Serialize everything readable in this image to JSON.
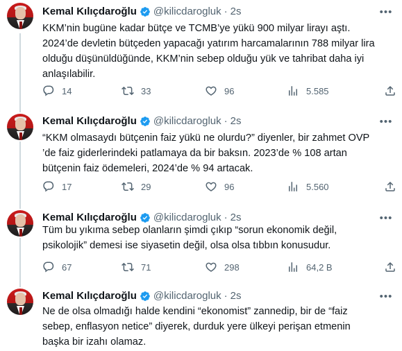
{
  "author": {
    "name": "Kemal Kılıçdaroğlu",
    "handle": "@kilicdarogluk",
    "separator": "·",
    "time": "2s"
  },
  "tweets": [
    {
      "text": "KKM’nin bugüne kadar bütçe ve TCMB’ye yükü 900 milyar lirayı aştı.\n2024’de devletin bütçeden yapacağı yatırım harcamalarının 788 milyar lira\nolduğu düşünüldüğünde, KKM’nin sebep olduğu yük ve tahribat daha iyi\nanlaşılabilir.",
      "replies": "14",
      "retweets": "33",
      "likes": "96",
      "views": "5.585"
    },
    {
      "text": "“KKM olmasaydı bütçenin faiz yükü ne olurdu?” diyenler, bir zahmet OVP\n’de faiz giderlerindeki patlamaya da bir baksın. 2023’de % 108 artan\nbütçenin faiz ödemeleri, 2024’de % 94 artacak.",
      "replies": "17",
      "retweets": "29",
      "likes": "96",
      "views": "5.560"
    },
    {
      "text": "Tüm bu yıkıma sebep olanların şimdi çıkıp “sorun ekonomik değil,\npsikolojik” demesi ise siyasetin değil, olsa olsa tıbbın konusudur.",
      "replies": "67",
      "retweets": "71",
      "likes": "298",
      "views": "64,2 B"
    },
    {
      "text": "Ne de olsa olmadığı halde kendini “ekonomist” zannedip, bir de “faiz\nsebep, enflasyon netice” diyerek, durduk yere ülkeyi perişan etmenin\nbaşka bir izahı olamaz."
    }
  ],
  "colors": {
    "text": "#0f1419",
    "secondary": "#536471",
    "verified": "#1d9bf0",
    "thread_line": "#cfd9de"
  },
  "icons": [
    "verified-badge-icon",
    "more-icon",
    "reply-icon",
    "retweet-icon",
    "like-icon",
    "views-icon",
    "share-icon"
  ]
}
